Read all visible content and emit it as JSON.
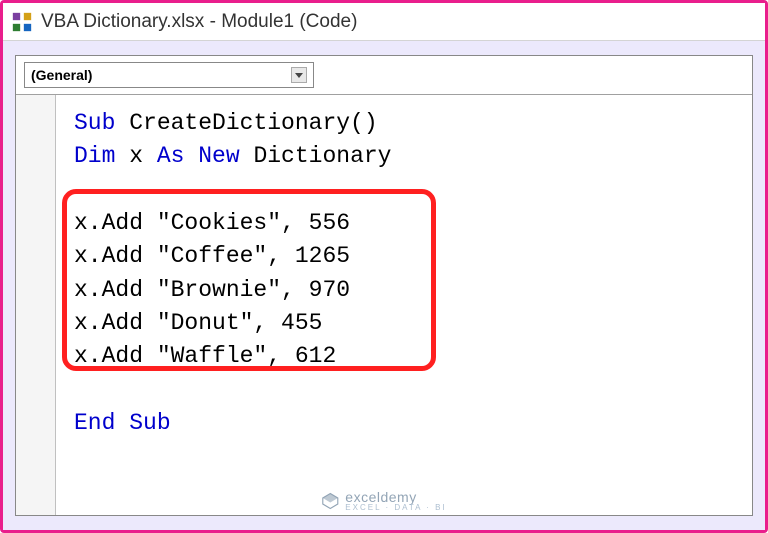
{
  "titlebar": {
    "title": "VBA Dictionary.xlsx - Module1 (Code)"
  },
  "dropdown": {
    "selected": "(General)"
  },
  "code": {
    "lines": [
      {
        "segments": [
          {
            "t": "Sub ",
            "kw": true
          },
          {
            "t": "CreateDictionary()",
            "kw": false
          }
        ]
      },
      {
        "segments": [
          {
            "t": "Dim ",
            "kw": true
          },
          {
            "t": "x ",
            "kw": false
          },
          {
            "t": "As New ",
            "kw": true
          },
          {
            "t": "Dictionary",
            "kw": false
          }
        ]
      },
      {
        "segments": [
          {
            "t": "",
            "kw": false
          }
        ]
      },
      {
        "segments": [
          {
            "t": "x.Add \"Cookies\", 556",
            "kw": false
          }
        ]
      },
      {
        "segments": [
          {
            "t": "x.Add \"Coffee\", 1265",
            "kw": false
          }
        ]
      },
      {
        "segments": [
          {
            "t": "x.Add \"Brownie\", 970",
            "kw": false
          }
        ]
      },
      {
        "segments": [
          {
            "t": "x.Add \"Donut\", 455",
            "kw": false
          }
        ]
      },
      {
        "segments": [
          {
            "t": "x.Add \"Waffle\", 612",
            "kw": false
          }
        ]
      },
      {
        "segments": [
          {
            "t": "",
            "kw": false
          }
        ]
      },
      {
        "segments": [
          {
            "t": "End Sub",
            "kw": true
          }
        ]
      }
    ]
  },
  "watermark": {
    "main": "exceldemy",
    "sub": "EXCEL · DATA · BI"
  }
}
